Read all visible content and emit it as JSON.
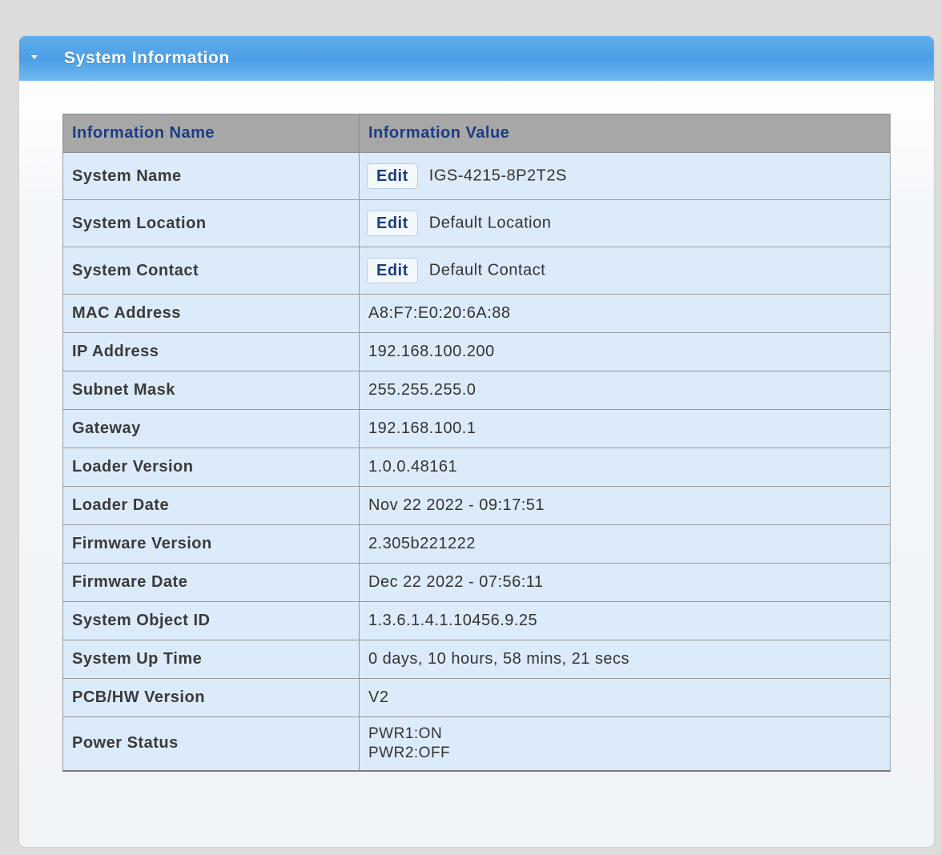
{
  "panel": {
    "title": "System Information",
    "collapse_icon": "caret-down-icon"
  },
  "table": {
    "header": {
      "name": "Information Name",
      "value": "Information Value"
    },
    "edit_label": "Edit",
    "rows": [
      {
        "name": "System Name",
        "value": "IGS-4215-8P2T2S"
      },
      {
        "name": "System Location",
        "value": "Default Location"
      },
      {
        "name": "System Contact",
        "value": "Default Contact"
      },
      {
        "name": "MAC Address",
        "value": "A8:F7:E0:20:6A:88"
      },
      {
        "name": "IP Address",
        "value": "192.168.100.200"
      },
      {
        "name": "Subnet Mask",
        "value": "255.255.255.0"
      },
      {
        "name": "Gateway",
        "value": "192.168.100.1"
      },
      {
        "name": "Loader Version",
        "value": "1.0.0.48161"
      },
      {
        "name": "Loader Date",
        "value": "Nov 22 2022 - 09:17:51"
      },
      {
        "name": "Firmware Version",
        "value": "2.305b221222"
      },
      {
        "name": "Firmware Date",
        "value": "Dec 22 2022 - 07:56:11"
      },
      {
        "name": "System Object ID",
        "value": "1.3.6.1.4.1.10456.9.25"
      },
      {
        "name": "System Up Time",
        "value": "0 days, 10 hours, 58 mins, 21 secs"
      },
      {
        "name": "PCB/HW Version",
        "value": "V2"
      },
      {
        "name": "Power Status",
        "value_lines": [
          "PWR1:ON",
          "PWR2:OFF"
        ]
      }
    ]
  }
}
